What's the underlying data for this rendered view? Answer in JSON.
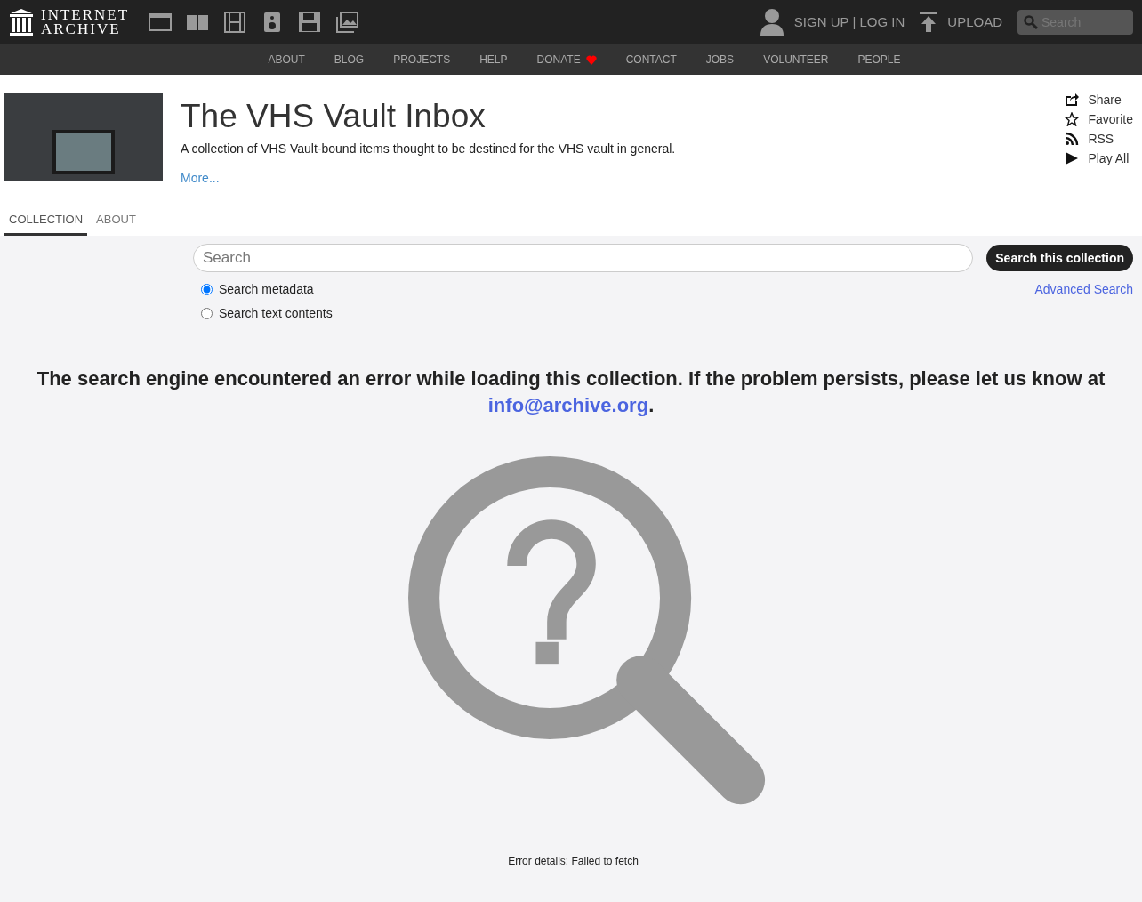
{
  "logo": {
    "line1": "INTERNET",
    "line2": "ARCHIVE"
  },
  "media_icons": [
    {
      "kind": "web"
    },
    {
      "kind": "texts"
    },
    {
      "kind": "video"
    },
    {
      "kind": "audio"
    },
    {
      "kind": "software"
    },
    {
      "kind": "images"
    }
  ],
  "account": {
    "signup": "SIGN UP",
    "separator": "|",
    "login": "LOG IN"
  },
  "upload": "UPLOAD",
  "top_search": {
    "placeholder": "Search"
  },
  "nav": [
    {
      "label": "ABOUT"
    },
    {
      "label": "BLOG"
    },
    {
      "label": "PROJECTS"
    },
    {
      "label": "HELP"
    },
    {
      "label": "DONATE",
      "heart": true
    },
    {
      "label": "CONTACT"
    },
    {
      "label": "JOBS"
    },
    {
      "label": "VOLUNTEER"
    },
    {
      "label": "PEOPLE"
    }
  ],
  "collection": {
    "title": "The VHS Vault Inbox",
    "description": "A collection of VHS Vault-bound items thought to be destined for the VHS vault in general.",
    "more": "More..."
  },
  "actions": [
    {
      "kind": "share",
      "label": "Share"
    },
    {
      "kind": "favorite",
      "label": "Favorite"
    },
    {
      "kind": "rss",
      "label": "RSS"
    },
    {
      "kind": "play",
      "label": "Play All"
    }
  ],
  "tabs": [
    {
      "label": "COLLECTION",
      "selected": true
    },
    {
      "label": "ABOUT",
      "selected": false
    }
  ],
  "search": {
    "placeholder": "Search",
    "button": "Search this collection",
    "advanced": "Advanced Search",
    "options": [
      {
        "label": "Search metadata",
        "selected": true
      },
      {
        "label": "Search text contents",
        "selected": false
      }
    ]
  },
  "error": {
    "text": "The search engine encountered an error while loading this collection. If the problem persists, please let us know at",
    "link": "info@archive.org",
    "after": ".",
    "details": "Error details: Failed to fetch"
  }
}
